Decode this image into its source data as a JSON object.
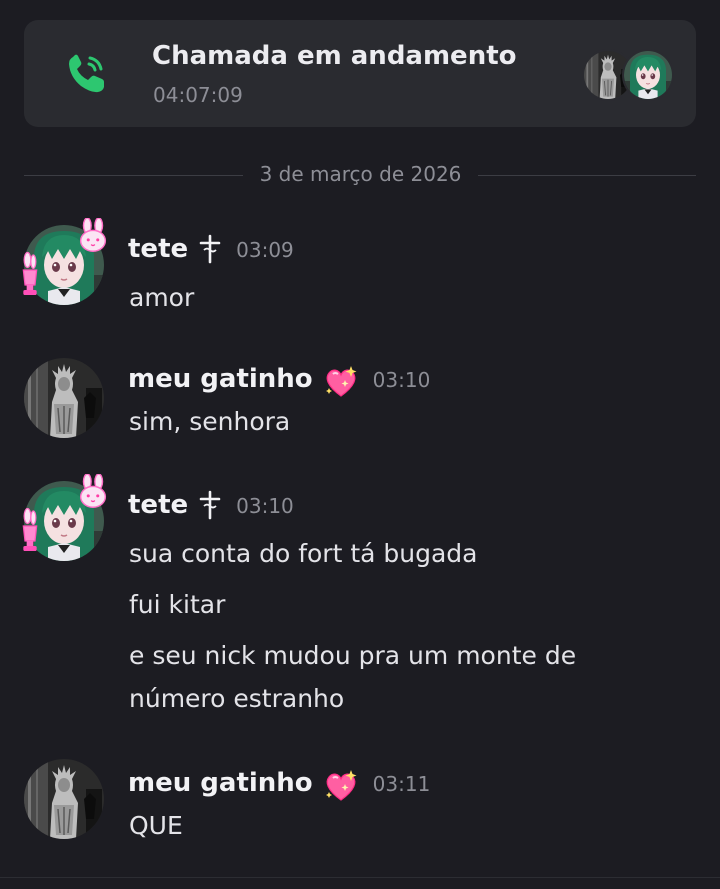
{
  "call": {
    "title": "Chamada em andamento",
    "timer": "04:07:09",
    "icon": "phone-call-icon",
    "accent": "#2dc770"
  },
  "date_divider": "3 de março de 2026",
  "messages": [
    {
      "author": "tete",
      "badge_icon": "cross-icon",
      "time": "03:09",
      "lines": [
        "amor"
      ]
    },
    {
      "author": "meu gatinho",
      "badge_icon": "sparkling-heart-icon",
      "time": "03:10",
      "lines": [
        "sim, senhora"
      ]
    },
    {
      "author": "tete",
      "badge_icon": "cross-icon",
      "time": "03:10",
      "lines": [
        "sua conta do fort tá bugada",
        "fui kitar",
        "e seu nick mudou pra um monte de",
        "número estranho"
      ]
    },
    {
      "author": "meu gatinho",
      "badge_icon": "sparkling-heart-icon",
      "time": "03:11",
      "lines": [
        "QUE"
      ]
    }
  ]
}
